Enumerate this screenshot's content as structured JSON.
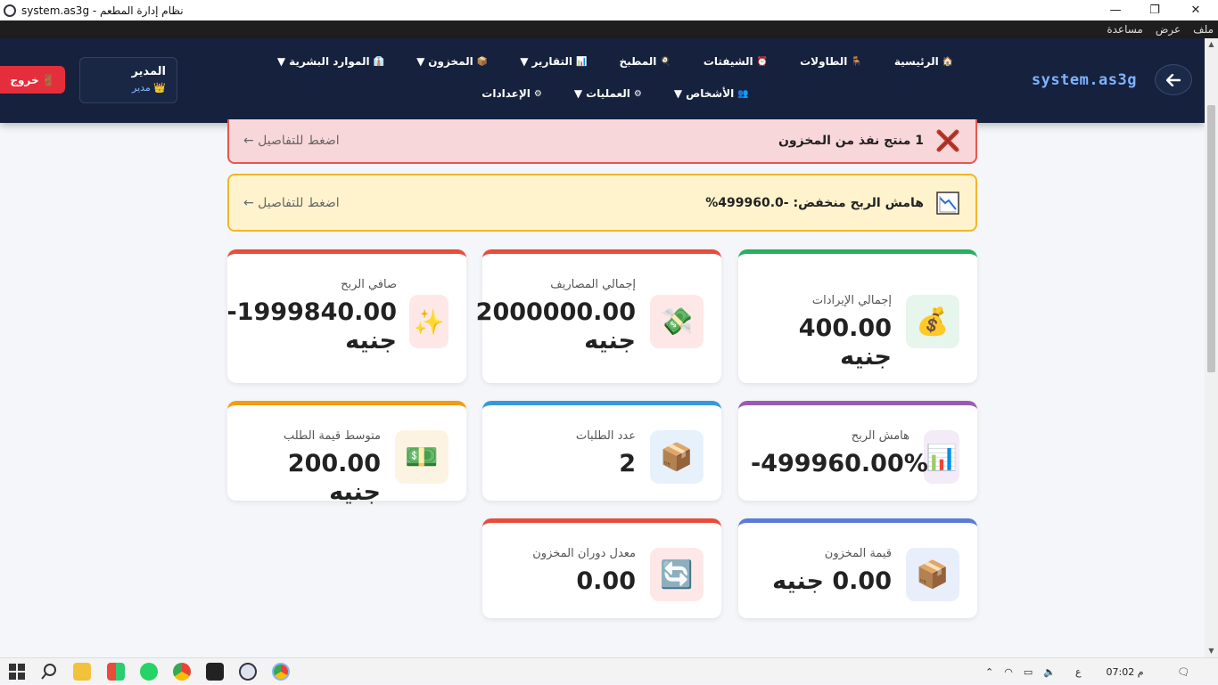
{
  "window": {
    "title": "system.as3g - نظام إدارة المطعم",
    "minimize": "—",
    "restore": "❐",
    "close": "✕"
  },
  "menu": [
    "ملف",
    "عرض",
    "مساعدة"
  ],
  "header": {
    "brand": "system.as3g",
    "back_icon": "arrow-left-icon",
    "nav": [
      {
        "label": "الرئيسية",
        "icon": "🏠",
        "dropdown": false
      },
      {
        "label": "الطاولات",
        "icon": "🪑",
        "dropdown": false
      },
      {
        "label": "الشيفتات",
        "icon": "⏰",
        "dropdown": false
      },
      {
        "label": "المطبخ",
        "icon": "🍳",
        "dropdown": false
      },
      {
        "label": "التقارير",
        "icon": "📊",
        "dropdown": true
      },
      {
        "label": "المخزون",
        "icon": "📦",
        "dropdown": true
      },
      {
        "label": "الموارد البشرية",
        "icon": "👔",
        "dropdown": true
      },
      {
        "label": "الأشخاص",
        "icon": "👥",
        "dropdown": true
      },
      {
        "label": "العمليات",
        "icon": "⚙",
        "dropdown": true
      },
      {
        "label": "الإعدادات",
        "icon": "⚙",
        "dropdown": false
      }
    ],
    "user": {
      "name": "المدير",
      "role": "مدير",
      "role_icon": "👑"
    },
    "logout": {
      "label": "خروج",
      "icon": "🚪"
    }
  },
  "alerts": [
    {
      "type": "danger",
      "text": "1 منتج نفذ من المخزون",
      "link": "اضغط للتفاصيل ←",
      "icon": "x-mark-icon",
      "color": "#c0392b"
    },
    {
      "type": "warning",
      "text": "هامش الربح منخفض: -499960.0%",
      "link": "اضغط للتفاصيل ←",
      "icon": "chart-decreasing-icon",
      "color": "#f3b62a"
    }
  ],
  "cards": [
    {
      "label": "إجمالي الإيرادات",
      "value": "400.00 جنيه",
      "icon": "money-bag-icon",
      "glyph": "💰",
      "accent": "#27ae60",
      "bg": "#e6f6ec"
    },
    {
      "label": "إجمالي المصاريف",
      "value": "2000000.00 جنيه",
      "icon": "money-wings-icon",
      "glyph": "💸",
      "accent": "#e74c3c",
      "bg": "#fde8e7"
    },
    {
      "label": "صافي الربح",
      "value": "1999840.00- جنيه",
      "icon": "sparkles-icon",
      "glyph": "✨",
      "accent": "#e74c3c",
      "bg": "#fde8e7"
    },
    {
      "label": "هامش الربح",
      "value": "-499960.00%",
      "icon": "bar-chart-icon",
      "glyph": "📊",
      "accent": "#9b59b6",
      "bg": "#f3ebf7"
    },
    {
      "label": "عدد الطلبات",
      "value": "2",
      "icon": "package-icon",
      "glyph": "📦",
      "accent": "#3498db",
      "bg": "#e6f1fb"
    },
    {
      "label": "متوسط قيمة الطلب",
      "value": "200.00 جنيه",
      "icon": "dollar-bill-icon",
      "glyph": "💵",
      "accent": "#f39c12",
      "bg": "#fdf3e3"
    },
    {
      "label": "قيمة المخزون",
      "value": "0.00 جنيه",
      "icon": "package-icon",
      "glyph": "📦",
      "accent": "#5b7bd5",
      "bg": "#e9eefb"
    },
    {
      "label": "معدل دوران المخزون",
      "value": "0.00",
      "icon": "refresh-icon",
      "glyph": "🔄",
      "accent": "#e74c3c",
      "bg": "#fde8e7"
    }
  ],
  "taskbar": {
    "time": "07:02 م",
    "lang": "ع"
  }
}
